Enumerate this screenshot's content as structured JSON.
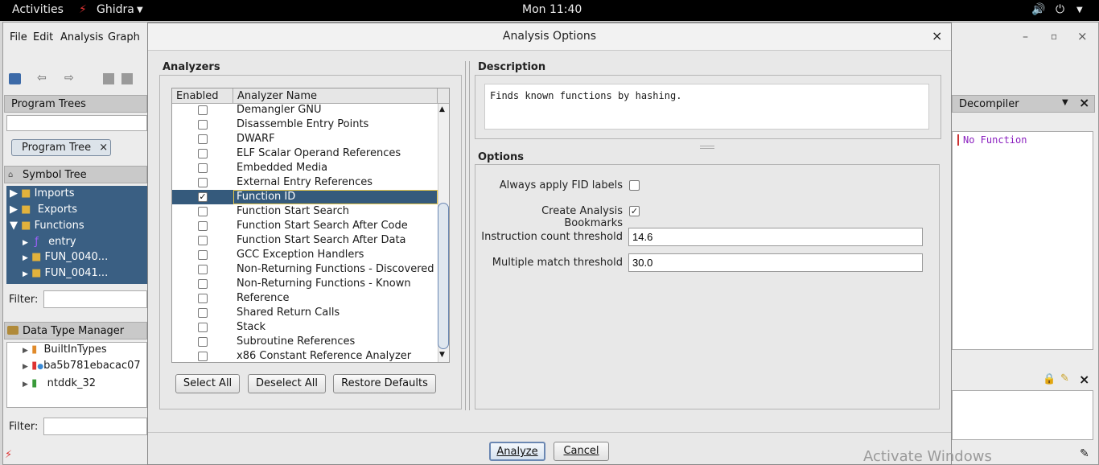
{
  "topbar": {
    "activities": "Activities",
    "app_name": "Ghidra",
    "clock": "Mon 11:40"
  },
  "menu": {
    "file": "File",
    "edit": "Edit",
    "analysis": "Analysis",
    "graph": "Graph"
  },
  "program_trees": {
    "title": "Program Trees",
    "tab": "Program Tree",
    "tab_close": "×"
  },
  "symbol_tree": {
    "title": "Symbol Tree",
    "items": [
      {
        "label": "Imports"
      },
      {
        "label": "Exports"
      },
      {
        "label": "Functions"
      },
      {
        "label": "entry"
      },
      {
        "label": "FUN_0040..."
      },
      {
        "label": "FUN_0041..."
      }
    ],
    "filter_label": "Filter:"
  },
  "data_type_manager": {
    "title": "Data Type Manager",
    "items": [
      {
        "label": "BuiltInTypes"
      },
      {
        "label": "ba5b781ebacac07"
      },
      {
        "label": "ntddk_32"
      }
    ],
    "filter_label": "Filter:"
  },
  "decompiler": {
    "title": "Decompiler",
    "content": "No Function"
  },
  "dialog": {
    "title": "Analysis Options",
    "close": "×",
    "analyzers_title": "Analyzers",
    "col_enabled": "Enabled",
    "col_name": "Analyzer Name",
    "analyzers": [
      {
        "name": "Demangler GNU",
        "enabled": false
      },
      {
        "name": "Disassemble Entry Points",
        "enabled": false
      },
      {
        "name": "DWARF",
        "enabled": false
      },
      {
        "name": "ELF Scalar Operand References",
        "enabled": false
      },
      {
        "name": "Embedded Media",
        "enabled": false
      },
      {
        "name": "External Entry References",
        "enabled": false
      },
      {
        "name": "Function ID",
        "enabled": true,
        "selected": true
      },
      {
        "name": "Function Start Search",
        "enabled": false
      },
      {
        "name": "Function Start Search After Code",
        "enabled": false
      },
      {
        "name": "Function Start Search After Data",
        "enabled": false
      },
      {
        "name": "GCC Exception Handlers",
        "enabled": false
      },
      {
        "name": "Non-Returning Functions - Discovered",
        "enabled": false
      },
      {
        "name": "Non-Returning Functions - Known",
        "enabled": false
      },
      {
        "name": "Reference",
        "enabled": false
      },
      {
        "name": "Shared Return Calls",
        "enabled": false
      },
      {
        "name": "Stack",
        "enabled": false
      },
      {
        "name": "Subroutine References",
        "enabled": false
      },
      {
        "name": "x86 Constant Reference Analyzer",
        "enabled": false
      }
    ],
    "select_all": "Select All",
    "deselect_all": "Deselect All",
    "restore_defaults": "Restore Defaults",
    "description_title": "Description",
    "description": "Finds known functions by hashing.",
    "options_title": "Options",
    "options": {
      "always_apply_fid_label": "Always apply FID labels",
      "always_apply_fid_checked": false,
      "create_bookmarks_label": "Create Analysis Bookmarks",
      "create_bookmarks_checked": true,
      "instruction_count_label": "Instruction count threshold",
      "instruction_count_value": "14.6",
      "multiple_match_label": "Multiple match threshold",
      "multiple_match_value": "30.0"
    },
    "analyze": "Analyze",
    "cancel": "Cancel"
  },
  "watermark": "Activate Windows",
  "colors": {
    "selection": "#355a7c",
    "tree_selection": "#3a5f83",
    "decompiler_text": "#8a1fbf"
  }
}
